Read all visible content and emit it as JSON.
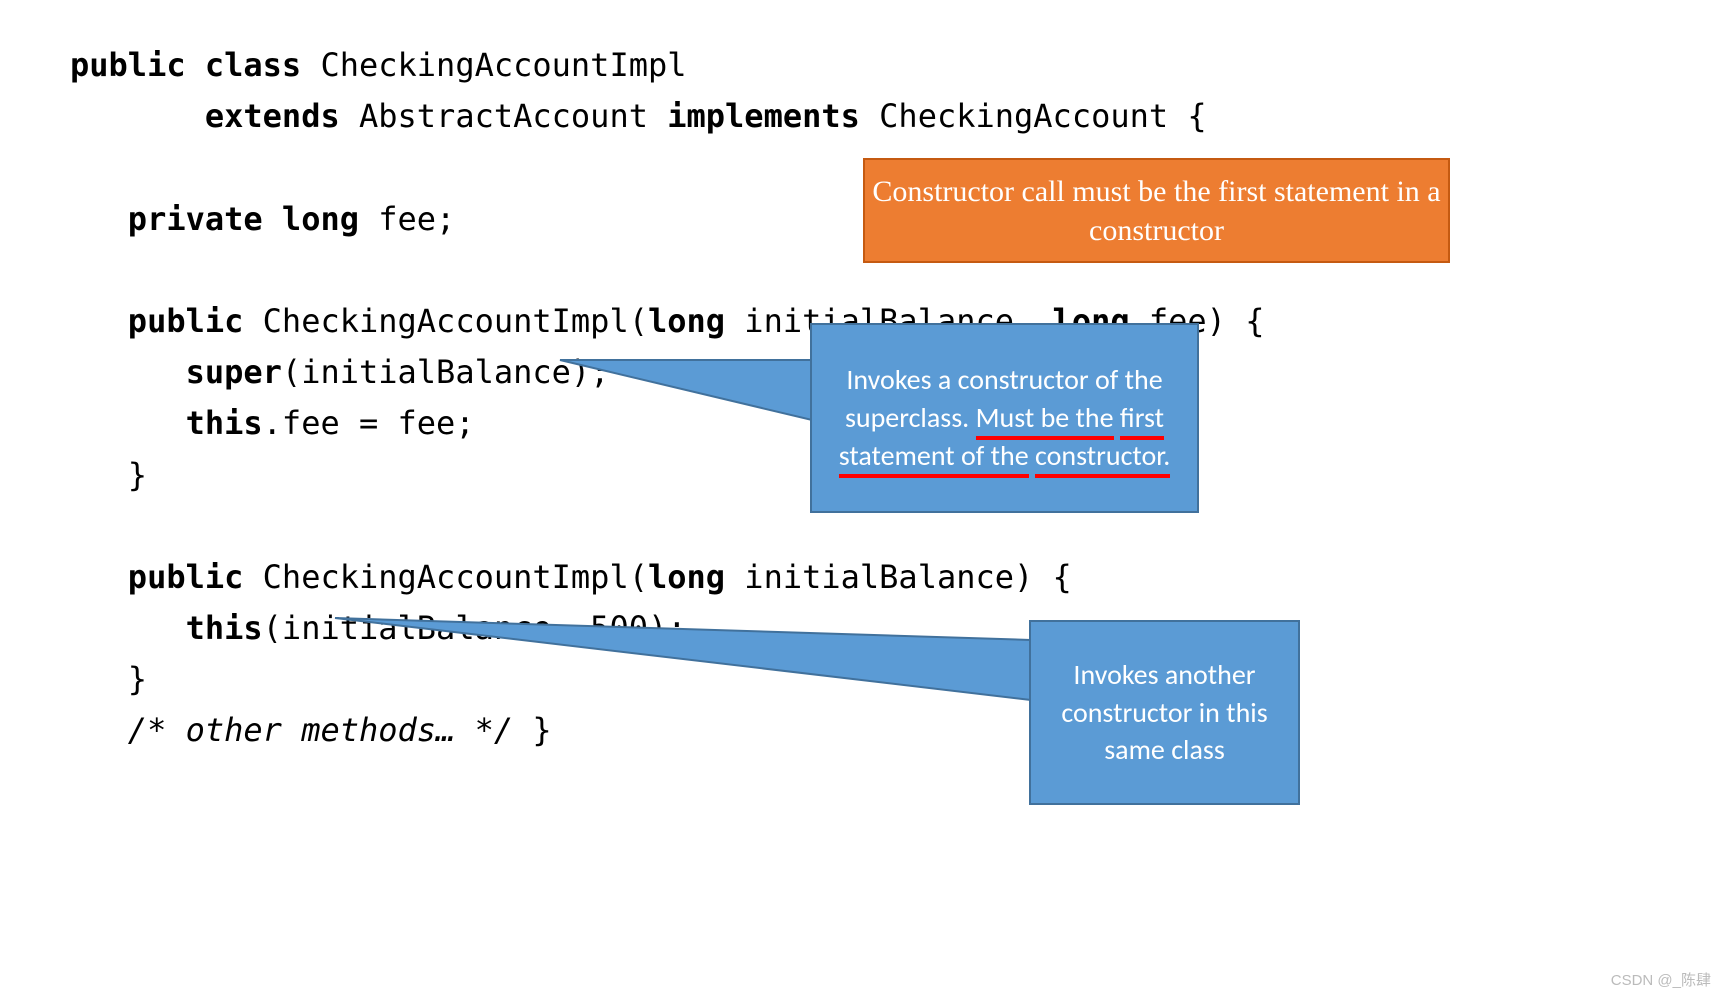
{
  "code": {
    "l1a": "public class",
    "l1b": " CheckingAccountImpl",
    "l2a": "       ",
    "l2b": "extends",
    "l2c": " AbstractAccount ",
    "l2d": "implements",
    "l2e": " CheckingAccount {",
    "l3": "",
    "l4a": "   ",
    "l4b": "private long",
    "l4c": " fee;",
    "l5": "",
    "l6a": "   ",
    "l6b": "public",
    "l6c": " CheckingAccountImpl(",
    "l6d": "long",
    "l6e": " initialBalance, ",
    "l6f": "long",
    "l6g": " fee) {",
    "l7a": "      ",
    "l7b": "super",
    "l7c": "(initialBalance);",
    "l8a": "      ",
    "l8b": "this",
    "l8c": ".fee = fee;",
    "l9": "   }",
    "l10": "",
    "l11a": "   ",
    "l11b": "public",
    "l11c": " CheckingAccountImpl(",
    "l11d": "long",
    "l11e": " initialBalance) {",
    "l12a": "      ",
    "l12b": "this",
    "l12c": "(initialBalance, 500);",
    "l13": "   }",
    "l14a": "   ",
    "l14b": "/* other methods… */",
    "l14c": " }"
  },
  "orange_box": "Constructor call must be the first statement in a constructor",
  "blue1": {
    "part1": "Invokes a constructor of the superclass. ",
    "u1": "Must be the",
    "sp": " ",
    "u2": "first statement of the",
    "sp2": " ",
    "u3": "constructor.",
    "full_plain": "Invokes a constructor of the superclass. Must be the first statement of the constructor."
  },
  "blue2": "Invokes another constructor in this same class",
  "credit": "CSDN @_陈肆"
}
